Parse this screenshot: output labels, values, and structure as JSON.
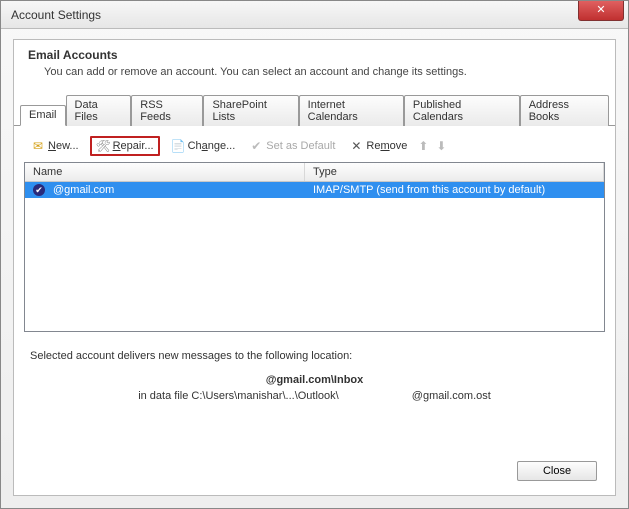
{
  "window": {
    "title": "Account Settings"
  },
  "header": {
    "title": "Email Accounts",
    "subtitle": "You can add or remove an account. You can select an account and change its settings."
  },
  "tabs": {
    "items": [
      {
        "label": "Email"
      },
      {
        "label": "Data Files"
      },
      {
        "label": "RSS Feeds"
      },
      {
        "label": "SharePoint Lists"
      },
      {
        "label": "Internet Calendars"
      },
      {
        "label": "Published Calendars"
      },
      {
        "label": "Address Books"
      }
    ]
  },
  "toolbar": {
    "new_label": "New...",
    "repair_label": "Repair...",
    "change_label": "Change...",
    "default_label": "Set as Default",
    "remove_label": "Remove"
  },
  "columns": {
    "name": "Name",
    "type": "Type"
  },
  "accounts": [
    {
      "name": "@gmail.com",
      "type": "IMAP/SMTP (send from this account by default)"
    }
  ],
  "delivery": {
    "intro": "Selected account delivers new messages to the following location:",
    "mailbox": "@gmail.com\\Inbox",
    "path_prefix": "in data file C:\\Users\\manishar\\...\\Outlook\\",
    "ost_file": "@gmail.com.ost"
  },
  "footer": {
    "close_label": "Close"
  }
}
